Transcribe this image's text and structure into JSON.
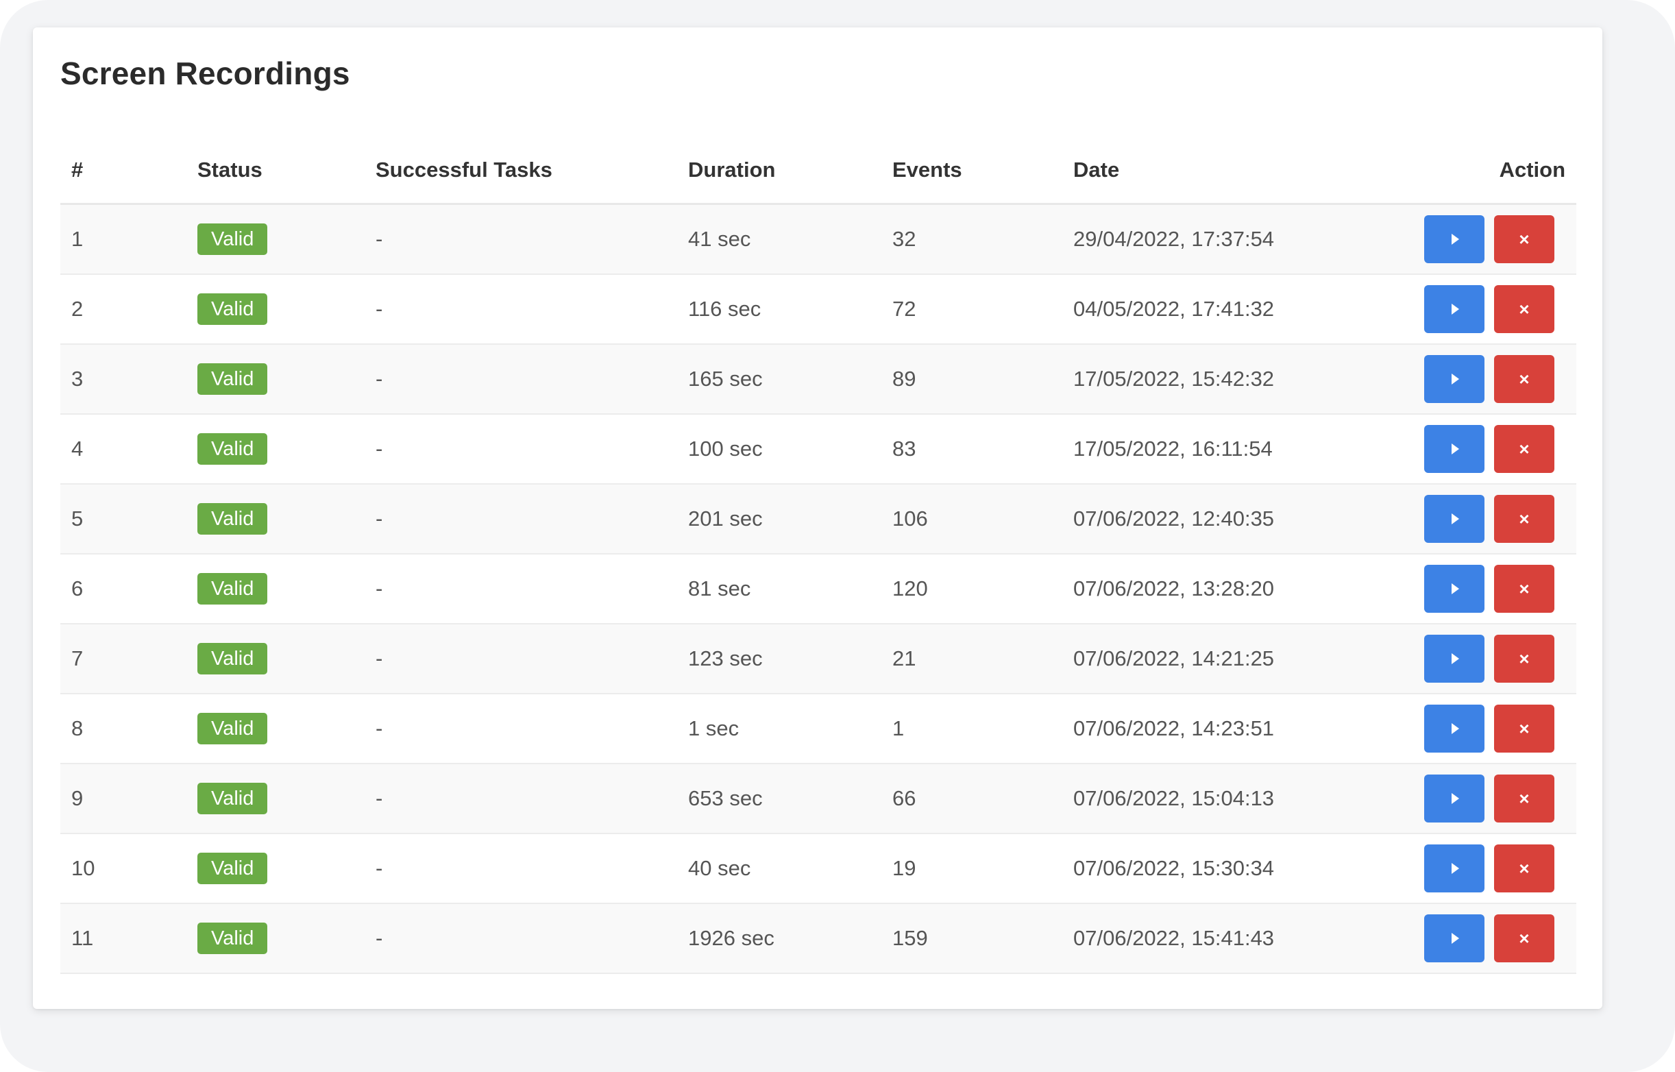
{
  "page": {
    "title": "Screen Recordings"
  },
  "table": {
    "headers": {
      "index": "#",
      "status": "Status",
      "tasks": "Successful Tasks",
      "duration": "Duration",
      "events": "Events",
      "date": "Date",
      "action": "Action"
    },
    "rows": [
      {
        "index": "1",
        "status": "Valid",
        "tasks": "-",
        "duration": "41 sec",
        "events": "32",
        "date": "29/04/2022, 17:37:54"
      },
      {
        "index": "2",
        "status": "Valid",
        "tasks": "-",
        "duration": "116 sec",
        "events": "72",
        "date": "04/05/2022, 17:41:32"
      },
      {
        "index": "3",
        "status": "Valid",
        "tasks": "-",
        "duration": "165 sec",
        "events": "89",
        "date": "17/05/2022, 15:42:32"
      },
      {
        "index": "4",
        "status": "Valid",
        "tasks": "-",
        "duration": "100 sec",
        "events": "83",
        "date": "17/05/2022, 16:11:54"
      },
      {
        "index": "5",
        "status": "Valid",
        "tasks": "-",
        "duration": "201 sec",
        "events": "106",
        "date": "07/06/2022, 12:40:35"
      },
      {
        "index": "6",
        "status": "Valid",
        "tasks": "-",
        "duration": "81 sec",
        "events": "120",
        "date": "07/06/2022, 13:28:20"
      },
      {
        "index": "7",
        "status": "Valid",
        "tasks": "-",
        "duration": "123 sec",
        "events": "21",
        "date": "07/06/2022, 14:21:25"
      },
      {
        "index": "8",
        "status": "Valid",
        "tasks": "-",
        "duration": "1 sec",
        "events": "1",
        "date": "07/06/2022, 14:23:51"
      },
      {
        "index": "9",
        "status": "Valid",
        "tasks": "-",
        "duration": "653 sec",
        "events": "66",
        "date": "07/06/2022, 15:04:13"
      },
      {
        "index": "10",
        "status": "Valid",
        "tasks": "-",
        "duration": "40 sec",
        "events": "19",
        "date": "07/06/2022, 15:30:34"
      },
      {
        "index": "11",
        "status": "Valid",
        "tasks": "-",
        "duration": "1926 sec",
        "events": "159",
        "date": "07/06/2022, 15:41:43"
      }
    ]
  },
  "actions": {
    "play_icon": "play-icon",
    "delete_icon": "close-icon",
    "delete_glyph": "×"
  },
  "colors": {
    "valid_badge": "#6aab45",
    "play_button": "#3d82e5",
    "delete_button": "#d8413a"
  }
}
